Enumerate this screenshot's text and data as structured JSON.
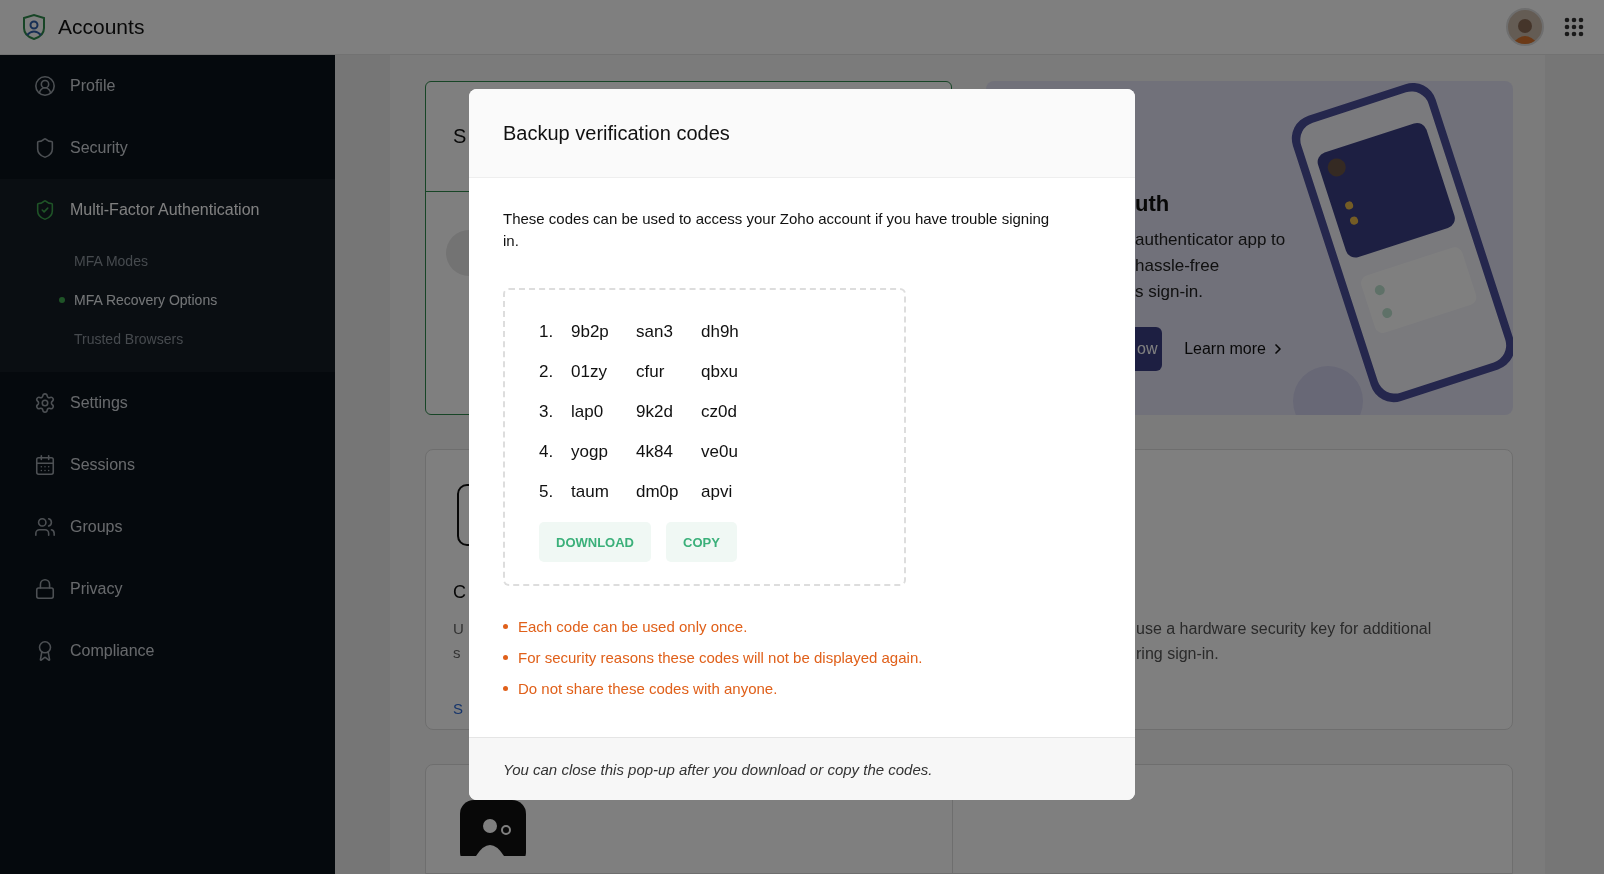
{
  "app": {
    "title": "Accounts"
  },
  "sidebar": {
    "items": [
      {
        "label": "Profile",
        "selected": false
      },
      {
        "label": "Security",
        "selected": false
      },
      {
        "label": "Multi-Factor Authentication",
        "selected": true,
        "children": [
          {
            "label": "MFA Modes",
            "selected": false
          },
          {
            "label": "MFA Recovery Options",
            "selected": true
          },
          {
            "label": "Trusted Browsers",
            "selected": false
          }
        ]
      },
      {
        "label": "Settings",
        "selected": false
      },
      {
        "label": "Sessions",
        "selected": false
      },
      {
        "label": "Groups",
        "selected": false
      },
      {
        "label": "Privacy",
        "selected": false
      },
      {
        "label": "Compliance",
        "selected": false
      }
    ]
  },
  "background": {
    "first_card": {
      "title": "S"
    },
    "banner": {
      "title": "uth",
      "lines": [
        "authenticator app to",
        "hassle-free",
        "s sign-in."
      ],
      "button": "ow",
      "link": "Learn more"
    },
    "second_card": {
      "title": "C",
      "lines": [
        "U",
        "s"
      ],
      "link": "S",
      "right_lines": [
        "use a hardware security key for additional",
        "ring sign-in."
      ]
    }
  },
  "modal": {
    "title": "Backup verification codes",
    "description": "These codes can be used to access your Zoho account if you have trouble signing in.",
    "codes": [
      {
        "number": "1.",
        "parts": [
          "9b2p",
          "san3",
          "dh9h"
        ]
      },
      {
        "number": "2.",
        "parts": [
          "01zy",
          "cfur",
          "qbxu"
        ]
      },
      {
        "number": "3.",
        "parts": [
          "lap0",
          "9k2d",
          "cz0d"
        ]
      },
      {
        "number": "4.",
        "parts": [
          "yogp",
          "4k84",
          "ve0u"
        ]
      },
      {
        "number": "5.",
        "parts": [
          "taum",
          "dm0p",
          "apvi"
        ]
      }
    ],
    "buttons": [
      "DOWNLOAD",
      "COPY"
    ],
    "notes": [
      "Each code can be used only once.",
      "For security reasons these codes will not be displayed again.",
      "Do not share these codes with anyone."
    ],
    "footer": "You can close this pop-up after you download or copy the codes."
  }
}
